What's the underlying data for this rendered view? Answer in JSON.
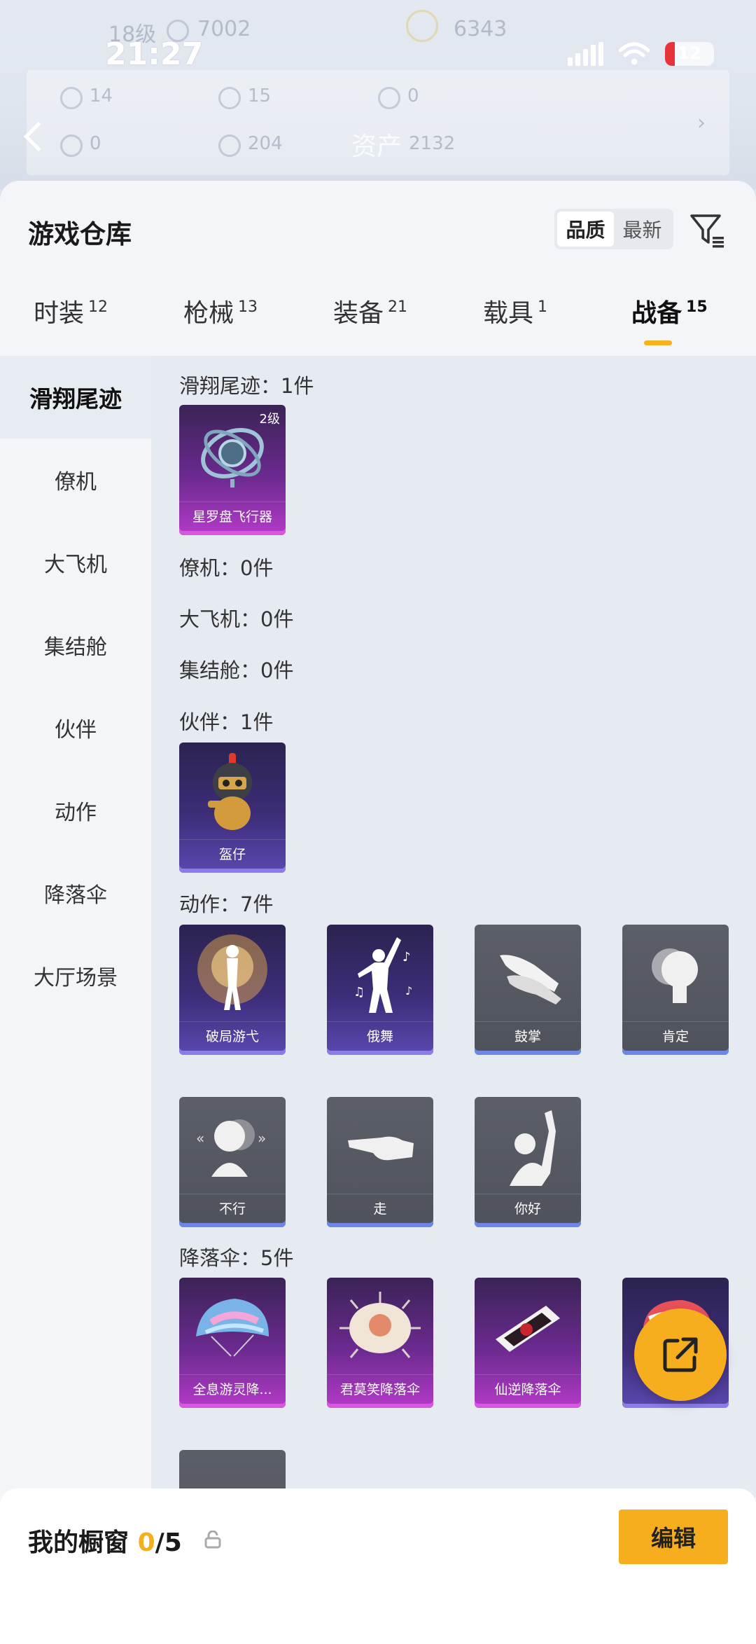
{
  "status_bar": {
    "time": "21:27",
    "battery": "12"
  },
  "background_header": {
    "level": "18级",
    "coins": "7002",
    "score": "6343",
    "stats": [
      "14",
      "15",
      "0",
      "0",
      "204"
    ],
    "assets_label": "资产",
    "assets_value": "2132"
  },
  "header": {
    "title": "游戏仓库",
    "sort_options": [
      "品质",
      "最新"
    ],
    "active_sort": "品质"
  },
  "tabs": [
    {
      "label": "时装",
      "count": "12"
    },
    {
      "label": "枪械",
      "count": "13"
    },
    {
      "label": "装备",
      "count": "21"
    },
    {
      "label": "载具",
      "count": "1"
    },
    {
      "label": "战备",
      "count": "15",
      "active": true
    }
  ],
  "sidenav": [
    "滑翔尾迹",
    "僚机",
    "大飞机",
    "集结舱",
    "伙伴",
    "动作",
    "降落伞",
    "大厅场景"
  ],
  "sections": {
    "glide": {
      "title": "滑翔尾迹：1件",
      "items": [
        {
          "name": "星罗盘飞行器",
          "level": "2级"
        }
      ]
    },
    "wingman": {
      "title": "僚机：0件"
    },
    "plane": {
      "title": "大飞机：0件"
    },
    "pod": {
      "title": "集结舱：0件"
    },
    "partner": {
      "title": "伙伴：1件",
      "items": [
        {
          "name": "盔仔"
        }
      ]
    },
    "emote": {
      "title": "动作：7件",
      "items": [
        {
          "name": "破局游弋"
        },
        {
          "name": "俄舞"
        },
        {
          "name": "鼓掌"
        },
        {
          "name": "肯定"
        },
        {
          "name": "不行"
        },
        {
          "name": "走"
        },
        {
          "name": "你好"
        }
      ]
    },
    "parachute": {
      "title": "降落伞：5件",
      "items": [
        {
          "name": "全息游灵降..."
        },
        {
          "name": "君莫笑降落伞"
        },
        {
          "name": "仙逆降落伞"
        }
      ]
    }
  },
  "bottom_bar": {
    "label": "我的橱窗",
    "count_current": "0",
    "count_total": "/5",
    "edit_label": "编辑"
  },
  "colors": {
    "accent": "#f6ae1f",
    "purple_rarity": "#b43ac7",
    "blue_rarity": "#6e86e6"
  }
}
